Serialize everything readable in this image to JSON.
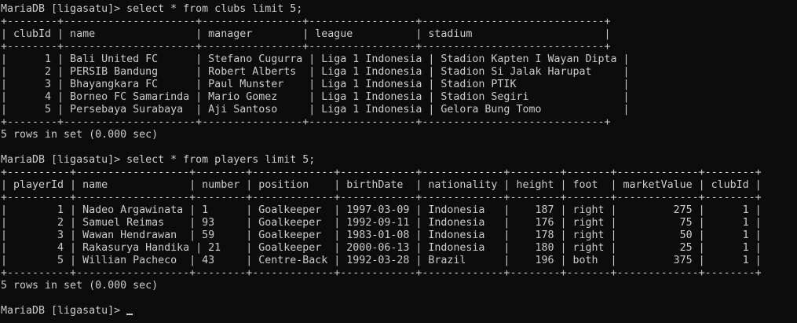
{
  "colors": {
    "background": "#0c0c0c",
    "foreground": "#cccccc"
  },
  "terminal": {
    "lines": [
      "MariaDB [ligasatu]> select * from clubs limit 5;",
      "+--------+---------------------+----------------+-----------------+-----------------------------+",
      "| clubId | name                | manager        | league          | stadium                     |",
      "+--------+---------------------+----------------+-----------------+-----------------------------+",
      "|      1 | Bali United FC      | Stefano Cugurra | Liga 1 Indonesia | Stadion Kapten I Wayan Dipta |",
      "|      2 | PERSIB Bandung      | Robert Alberts  | Liga 1 Indonesia | Stadion Si Jalak Harupat     |",
      "|      3 | Bhayangkara FC      | Paul Munster    | Liga 1 Indonesia | Stadion PTIK                 |",
      "|      4 | Borneo FC Samarinda | Mario Gomez     | Liga 1 Indonesia | Stadion Segiri               |",
      "|      5 | Persebaya Surabaya  | Aji Santoso     | Liga 1 Indonesia | Gelora Bung Tomo             |",
      "+--------+---------------------+----------------+-----------------+-----------------------------+",
      "5 rows in set (0.000 sec)",
      "",
      "MariaDB [ligasatu]> select * from players limit 5;",
      "+----------+------------------+--------+-------------+------------+-------------+--------+-------+-------------+--------+",
      "| playerId | name             | number | position    | birthDate  | nationality | height | foot  | marketValue | clubId |",
      "+----------+------------------+--------+-------------+------------+-------------+--------+-------+-------------+--------+",
      "|        1 | Nadeo Argawinata | 1      | Goalkeeper  | 1997-03-09 | Indonesia   |    187 | right |         275 |      1 |",
      "|        2 | Samuel Reimas    | 93     | Goalkeeper  | 1992-09-11 | Indonesia   |    176 | right |          75 |      1 |",
      "|        3 | Wawan Hendrawan  | 59     | Goalkeeper  | 1983-01-08 | Indonesia   |    178 | right |          50 |      1 |",
      "|        4 | Rakasurya Handika | 21    | Goalkeeper  | 2000-06-13 | Indonesia   |    180 | right |          25 |      1 |",
      "|        5 | Willian Pacheco  | 43     | Centre-Back | 1992-03-28 | Brazil      |    196 | both  |         375 |      1 |",
      "+----------+------------------+--------+-------------+------------+-------------+--------+-------+-------------+--------+",
      "5 rows in set (0.000 sec)",
      "",
      "MariaDB [ligasatu]> "
    ]
  }
}
